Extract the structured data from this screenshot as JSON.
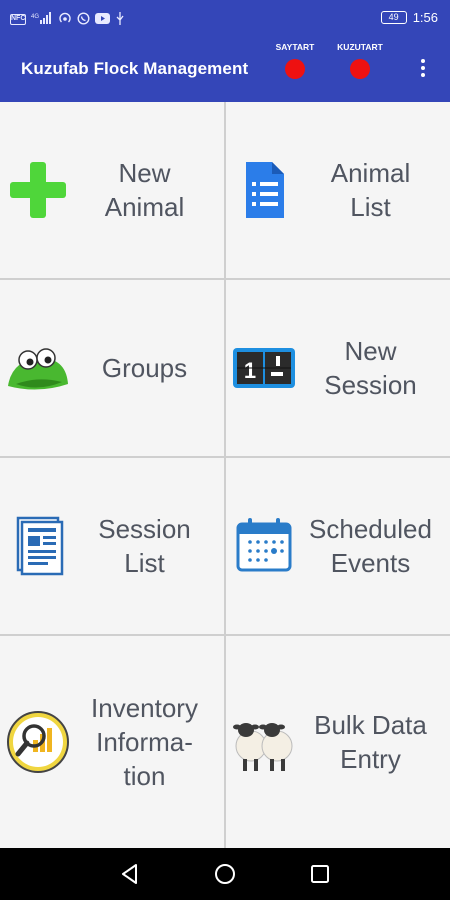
{
  "status": {
    "nfc": "NFC",
    "signal": "4G",
    "time": "1:56",
    "battery": "49"
  },
  "appbar": {
    "title": "Kuzufab Flock Management",
    "indicators": [
      {
        "label": "SAYTART",
        "color": "#ee1111"
      },
      {
        "label": "KUZUTART",
        "color": "#ee1111"
      }
    ]
  },
  "tiles": [
    {
      "label": "New\nAnimal",
      "icon": "plus-icon"
    },
    {
      "label": "Animal\nList",
      "icon": "document-list-icon"
    },
    {
      "label": "Groups",
      "icon": "frog-eyes-icon"
    },
    {
      "label": "New\nSession",
      "icon": "counter-icon"
    },
    {
      "label": "Session\nList",
      "icon": "newspaper-icon"
    },
    {
      "label": "Scheduled\nEvents",
      "icon": "calendar-icon"
    },
    {
      "label": "Inventory\nInforma-\ntion",
      "icon": "magnifier-chart-icon"
    },
    {
      "label": "Bulk Data\nEntry",
      "icon": "sheep-icon"
    }
  ],
  "colors": {
    "primary": "#3446b8",
    "indicator": "#ee1111",
    "tile_bg": "#f5f5f5",
    "tile_text": "#505560"
  }
}
